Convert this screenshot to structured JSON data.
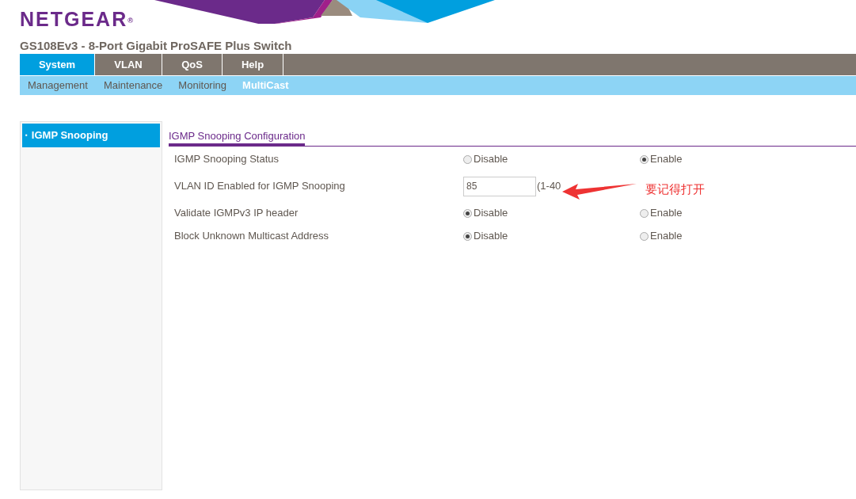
{
  "brand": {
    "logo": "NETGEAR",
    "registered": "®"
  },
  "product_title": "GS108Ev3 - 8-Port Gigabit ProSAFE Plus Switch",
  "tabs": [
    {
      "label": "System",
      "selected": true
    },
    {
      "label": "VLAN",
      "selected": false
    },
    {
      "label": "QoS",
      "selected": false
    },
    {
      "label": "Help",
      "selected": false
    }
  ],
  "subtabs": [
    {
      "label": "Management",
      "selected": false
    },
    {
      "label": "Maintenance",
      "selected": false
    },
    {
      "label": "Monitoring",
      "selected": false
    },
    {
      "label": "MultiCast",
      "selected": true
    }
  ],
  "sidebar": {
    "items": [
      {
        "bullet": "▪",
        "label": "IGMP Snooping",
        "selected": true
      }
    ]
  },
  "section_title": "IGMP Snooping Configuration",
  "settings": [
    {
      "kind": "radio",
      "label": "IGMP Snooping Status",
      "options": [
        {
          "label": "Disable",
          "selected": false
        },
        {
          "label": "Enable",
          "selected": true
        }
      ]
    },
    {
      "kind": "input",
      "label": "VLAN ID Enabled for IGMP Snooping",
      "value": "85",
      "hint": "(1-40"
    },
    {
      "kind": "radio",
      "label": "Validate IGMPv3 IP header",
      "options": [
        {
          "label": "Disable",
          "selected": true
        },
        {
          "label": "Enable",
          "selected": false
        }
      ]
    },
    {
      "kind": "radio",
      "label": "Block Unknown Multicast Address",
      "options": [
        {
          "label": "Disable",
          "selected": true
        },
        {
          "label": "Enable",
          "selected": false
        }
      ]
    }
  ],
  "annotation": {
    "text": "要记得打开"
  }
}
